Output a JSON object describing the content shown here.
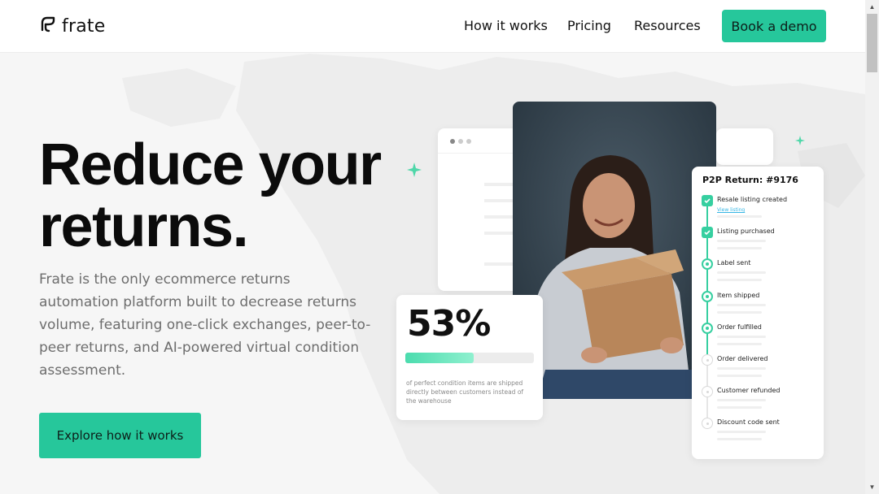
{
  "brand": {
    "name": "frate",
    "logo_icon": "frate-leaf-logo",
    "accent": "#26c79b"
  },
  "nav": {
    "items": [
      "How it works",
      "Pricing",
      "Resources"
    ],
    "cta": "Book a demo"
  },
  "hero": {
    "title_line1": "Reduce your",
    "title_line2": "returns.",
    "subtitle": "Frate is the only ecommerce returns automation platform built to decrease returns volume, featuring one-click exchanges, peer-to-peer returns, and AI-powered virtual condition assessment.",
    "cta": "Explore how it works"
  },
  "stat_card": {
    "value": "53%",
    "progress": 0.53,
    "caption": "of perfect condition items are shipped directly between customers instead of the warehouse"
  },
  "p2p_card": {
    "title": "P2P Return: #9176",
    "steps": [
      {
        "label": "Resale listing created",
        "link": "View listing",
        "state": "done"
      },
      {
        "label": "Listing purchased",
        "state": "done"
      },
      {
        "label": "Label sent",
        "state": "active"
      },
      {
        "label": "Item shipped",
        "state": "active"
      },
      {
        "label": "Order fulfilled",
        "state": "active"
      },
      {
        "label": "Order delivered",
        "state": "pending"
      },
      {
        "label": "Customer refunded",
        "state": "pending"
      },
      {
        "label": "Discount code sent",
        "state": "pending"
      }
    ]
  },
  "colors": {
    "accent": "#26c79b",
    "text_dark": "#0b0b0b",
    "text_muted": "#6d6d6d",
    "link": "#36b6e4"
  }
}
